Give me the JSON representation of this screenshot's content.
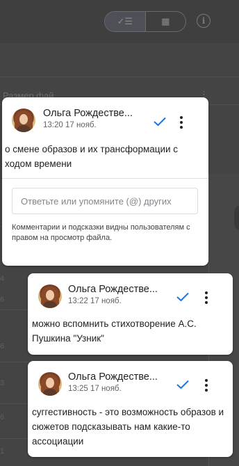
{
  "background": {
    "header_label": "Размер фай",
    "header_menu": "⋮",
    "row_values": [
      "4",
      "6",
      "6",
      "3",
      "6",
      "1"
    ]
  },
  "view_toggle": {
    "list_icon": "✓☰",
    "grid_icon": "▦"
  },
  "info_icon": "i",
  "comments": [
    {
      "author": "Ольга Рождестве...",
      "time": "13:20 17 нояб.",
      "text": "о смене образов и их трансформации с ходом времени",
      "reply_placeholder": "Ответьте или упомяните (@) других",
      "note": "Комментарии и подсказки видны пользователям с правом на просмотр файла."
    },
    {
      "author": "Ольга Рождестве...",
      "time": "13:22 17 нояб.",
      "text": "можно вспомнить стихотворение А.С. Пушкина \"Узник\""
    },
    {
      "author": "Ольга Рождестве...",
      "time": "13:25 17 нояб.",
      "text": "суггестивность - это возможность образов и сюжетов подсказывать нам какие-то ассоциации"
    }
  ],
  "colors": {
    "accent": "#1a73e8",
    "scrim": "#444445",
    "card": "#ffffff"
  }
}
